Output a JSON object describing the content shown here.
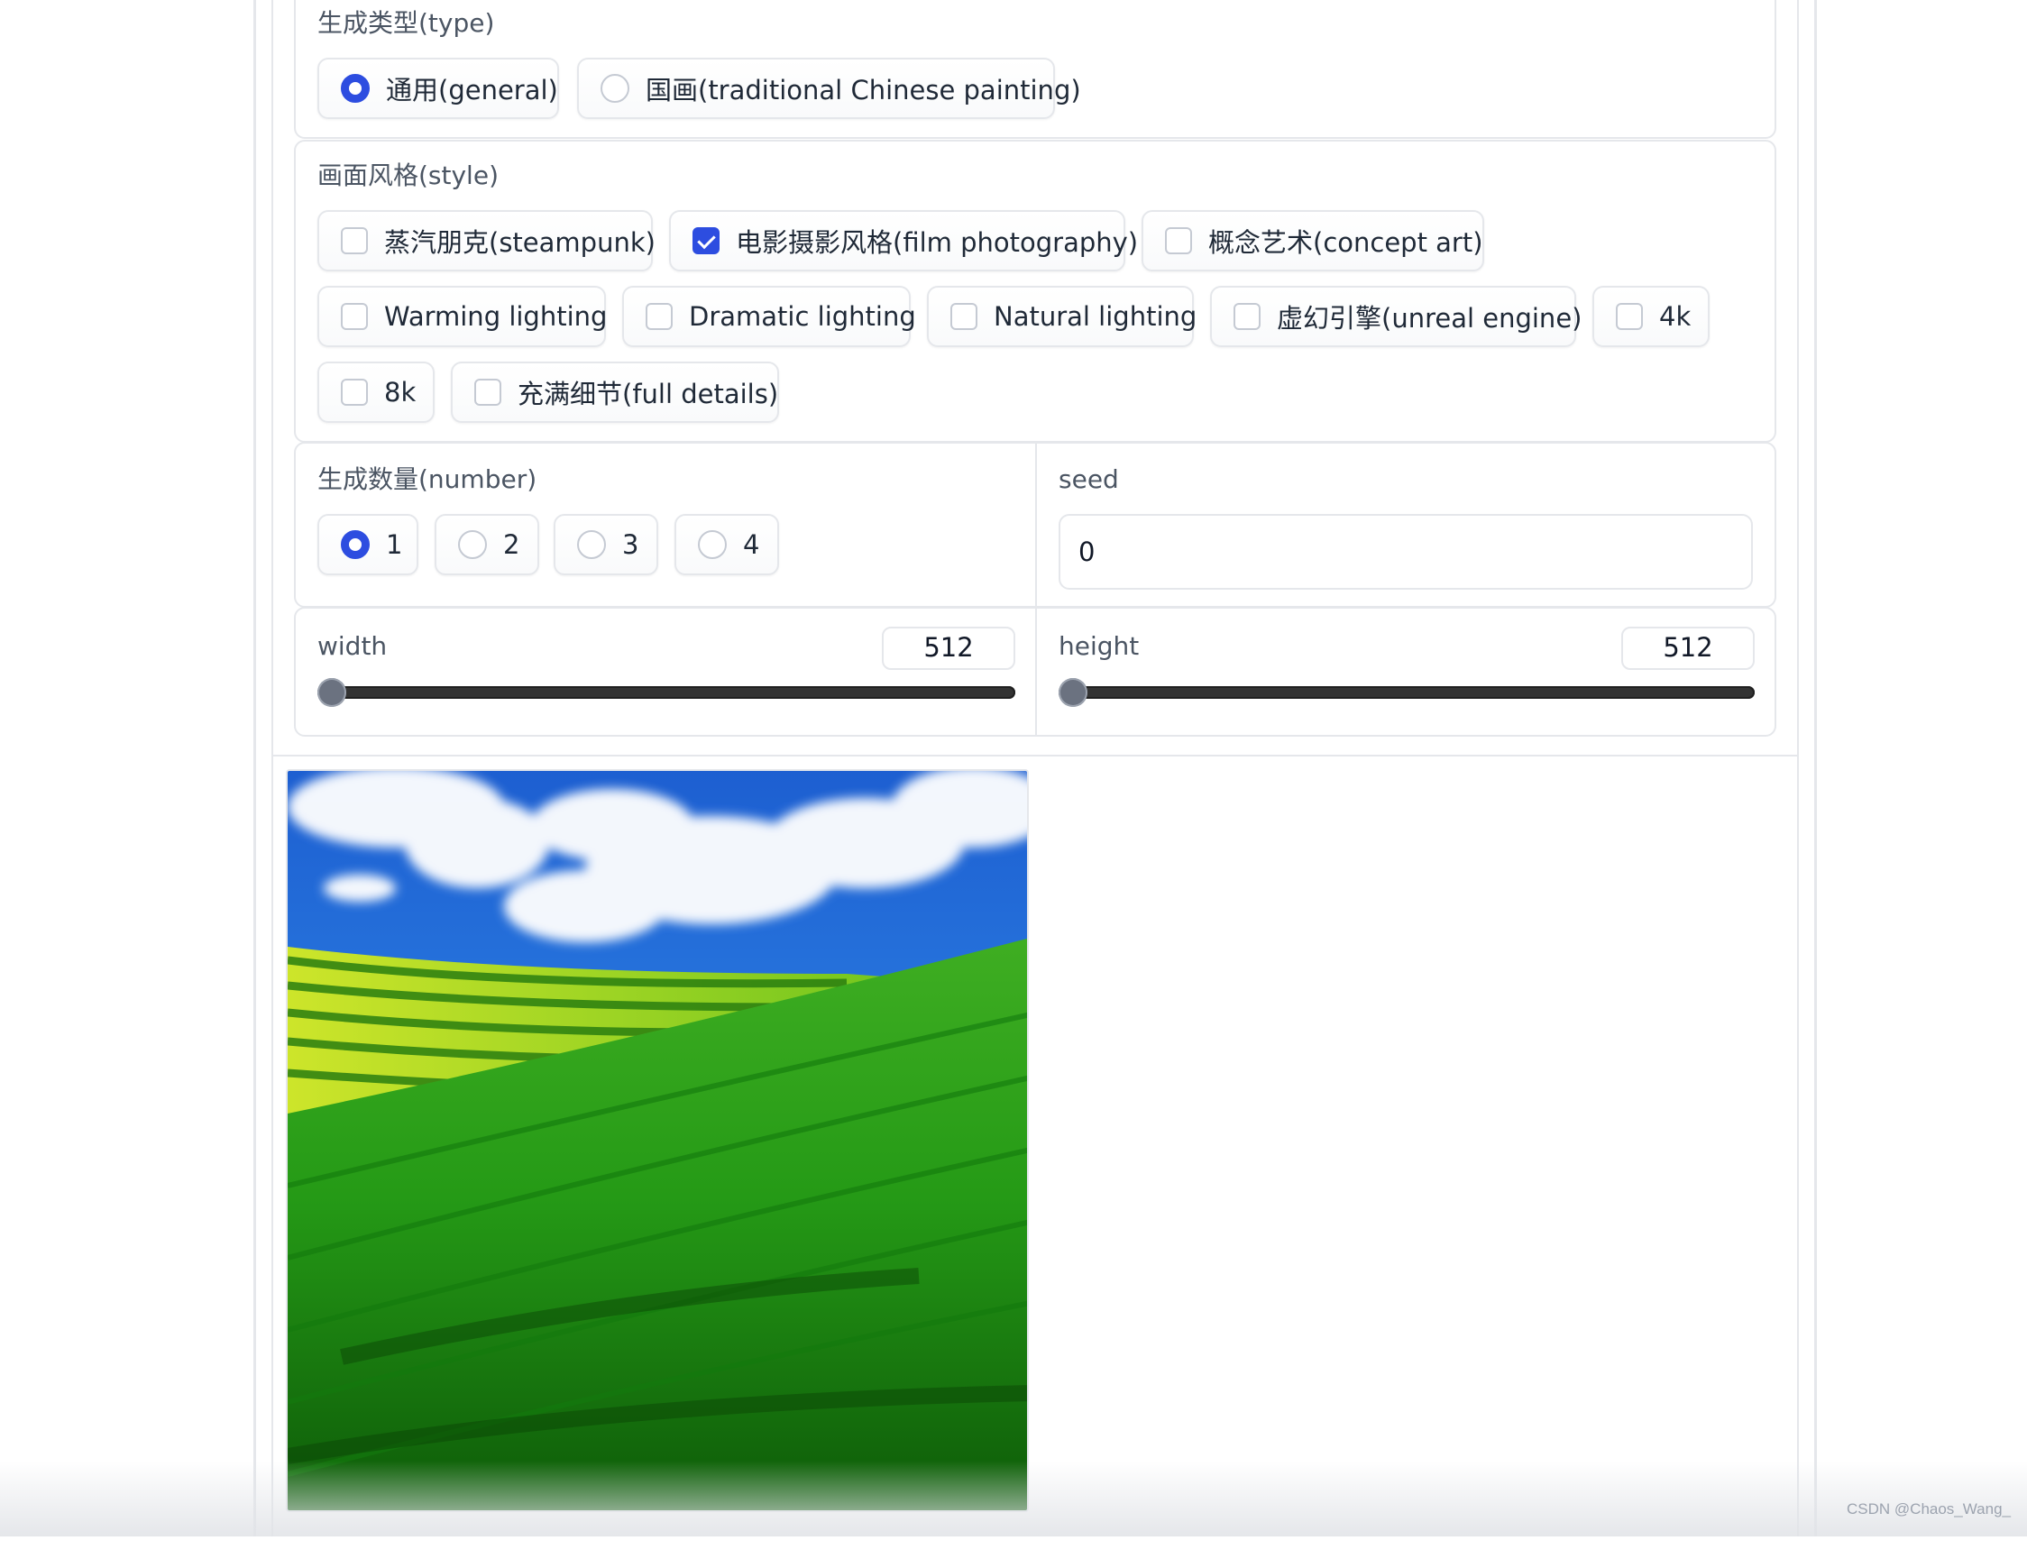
{
  "type_group": {
    "label": "生成类型(type)",
    "options": [
      {
        "label": "通用(general)",
        "selected": true
      },
      {
        "label": "国画(traditional Chinese painting)",
        "selected": false
      }
    ]
  },
  "style_group": {
    "label": "画面风格(style)",
    "options": [
      {
        "label": "蒸汽朋克(steampunk)",
        "checked": false
      },
      {
        "label": "电影摄影风格(film photography)",
        "checked": true
      },
      {
        "label": "概念艺术(concept art)",
        "checked": false
      },
      {
        "label": "Warming lighting",
        "checked": false
      },
      {
        "label": "Dramatic lighting",
        "checked": false
      },
      {
        "label": "Natural lighting",
        "checked": false
      },
      {
        "label": "虚幻引擎(unreal engine)",
        "checked": false
      },
      {
        "label": "4k",
        "checked": false
      },
      {
        "label": "8k",
        "checked": false
      },
      {
        "label": "充满细节(full details)",
        "checked": false
      }
    ]
  },
  "number_group": {
    "label": "生成数量(number)",
    "options": [
      {
        "label": "1",
        "selected": true
      },
      {
        "label": "2",
        "selected": false
      },
      {
        "label": "3",
        "selected": false
      },
      {
        "label": "4",
        "selected": false
      }
    ]
  },
  "seed": {
    "label": "seed",
    "value": "0"
  },
  "width": {
    "label": "width",
    "value": "512",
    "slider_fraction": 0.0
  },
  "height": {
    "label": "height",
    "value": "512",
    "slider_fraction": 0.0
  },
  "output": {
    "image_subject": "green grass hill landscape with blue sky and clouds"
  },
  "watermark": "CSDN @Chaos_Wang_",
  "colors": {
    "accent": "#2d4de0",
    "border": "#e5e7eb"
  }
}
